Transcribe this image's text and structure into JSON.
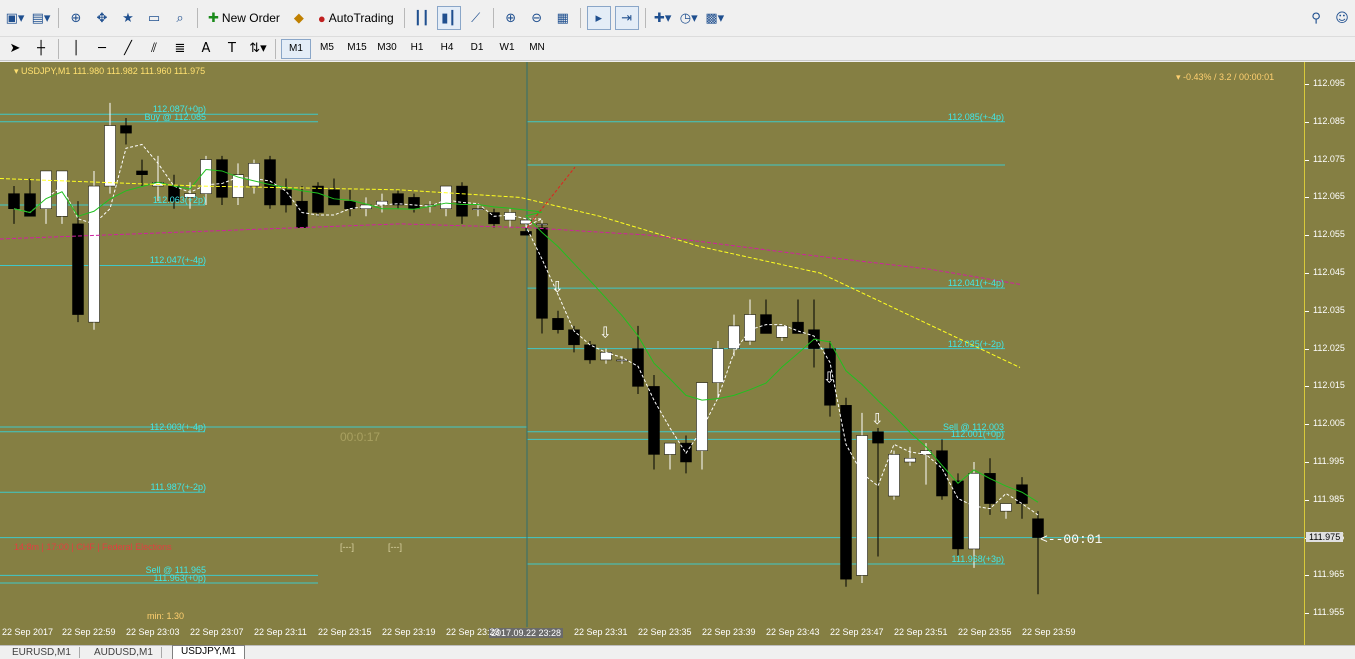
{
  "toolbar": {
    "new_order": "New Order",
    "auto_trading": "AutoTrading"
  },
  "timeframes": [
    "M1",
    "M5",
    "M15",
    "M30",
    "H1",
    "H4",
    "D1",
    "W1",
    "MN"
  ],
  "chart": {
    "header": "USDJPY,M1  111.980 111.982 111.960 111.975",
    "stats": "-0.43% / 3.2 / 00:00:01",
    "countdown": "<--00:01",
    "current_price": "111.975",
    "min_label": "min:  1.30",
    "watermark": "00:0:17",
    "mini1": "[---]",
    "mini2": "[---]",
    "news": "14:8m | 17:00 | CHF | Federal Elections",
    "crosshair_time": "2017.09.22 23:28",
    "price_ticks": [
      "112.095",
      "112.085",
      "112.075",
      "112.065",
      "112.055",
      "112.045",
      "112.035",
      "112.025",
      "112.015",
      "112.005",
      "111.995",
      "111.985",
      "111.975",
      "111.965",
      "111.955"
    ],
    "time_ticks": [
      "22 Sep 2017",
      "22 Sep 22:59",
      "22 Sep 23:03",
      "22 Sep 23:07",
      "22 Sep 23:11",
      "22 Sep 23:15",
      "22 Sep 23:19",
      "22 Sep 23:23",
      "22 Sep 23:31",
      "22 Sep 23:35",
      "22 Sep 23:39",
      "22 Sep 23:43",
      "22 Sep 23:47",
      "22 Sep 23:51",
      "22 Sep 23:55",
      "22 Sep 23:59"
    ],
    "levels_left": [
      {
        "price": 112.087,
        "text": "112.087(+0p)"
      },
      {
        "price": 112.085,
        "text": "Buy @ 112.085"
      },
      {
        "price": 112.063,
        "text": "112.063(+2p)"
      },
      {
        "price": 112.047,
        "text": "112.047(+-4p)"
      },
      {
        "price": 112.003,
        "text": "112.003(+-4p)"
      },
      {
        "price": 111.987,
        "text": "111.987(+-2p)"
      },
      {
        "price": 111.965,
        "text": "Sell @ 111.965"
      },
      {
        "price": 111.963,
        "text": "111.963(+0p)"
      }
    ],
    "levels_right": [
      {
        "price": 112.085,
        "text": "112.085(+-4p)"
      },
      {
        "price": 112.041,
        "text": "112.041(+-4p)"
      },
      {
        "price": 112.025,
        "text": "112.025(+-2p)"
      },
      {
        "price": 112.003,
        "text": "Sell @ 112.003"
      },
      {
        "price": 112.001,
        "text": "112.001(+0p)"
      },
      {
        "price": 111.968,
        "text": "111.968(+3p)"
      }
    ],
    "candles": [
      {
        "o": 112.066,
        "h": 112.068,
        "l": 112.058,
        "c": 112.062
      },
      {
        "o": 112.066,
        "h": 112.07,
        "l": 112.06,
        "c": 112.06
      },
      {
        "o": 112.062,
        "h": 112.065,
        "l": 112.058,
        "c": 112.072
      },
      {
        "o": 112.06,
        "h": 112.07,
        "l": 112.058,
        "c": 112.072
      },
      {
        "o": 112.058,
        "h": 112.064,
        "l": 112.032,
        "c": 112.034
      },
      {
        "o": 112.032,
        "h": 112.072,
        "l": 112.03,
        "c": 112.068
      },
      {
        "o": 112.068,
        "h": 112.09,
        "l": 112.066,
        "c": 112.084
      },
      {
        "o": 112.084,
        "h": 112.086,
        "l": 112.079,
        "c": 112.082
      },
      {
        "o": 112.072,
        "h": 112.075,
        "l": 112.068,
        "c": 112.071
      },
      {
        "o": 112.068,
        "h": 112.076,
        "l": 112.064,
        "c": 112.069
      },
      {
        "o": 112.068,
        "h": 112.071,
        "l": 112.062,
        "c": 112.064
      },
      {
        "o": 112.065,
        "h": 112.069,
        "l": 112.062,
        "c": 112.066
      },
      {
        "o": 112.066,
        "h": 112.076,
        "l": 112.063,
        "c": 112.075
      },
      {
        "o": 112.075,
        "h": 112.076,
        "l": 112.063,
        "c": 112.065
      },
      {
        "o": 112.065,
        "h": 112.074,
        "l": 112.063,
        "c": 112.071
      },
      {
        "o": 112.068,
        "h": 112.075,
        "l": 112.066,
        "c": 112.074
      },
      {
        "o": 112.075,
        "h": 112.076,
        "l": 112.062,
        "c": 112.063
      },
      {
        "o": 112.067,
        "h": 112.07,
        "l": 112.061,
        "c": 112.063
      },
      {
        "o": 112.064,
        "h": 112.068,
        "l": 112.058,
        "c": 112.057
      },
      {
        "o": 112.068,
        "h": 112.069,
        "l": 112.06,
        "c": 112.061
      },
      {
        "o": 112.067,
        "h": 112.07,
        "l": 112.063,
        "c": 112.063
      },
      {
        "o": 112.064,
        "h": 112.067,
        "l": 112.06,
        "c": 112.062
      },
      {
        "o": 112.062,
        "h": 112.065,
        "l": 112.06,
        "c": 112.063
      },
      {
        "o": 112.063,
        "h": 112.066,
        "l": 112.061,
        "c": 112.064
      },
      {
        "o": 112.066,
        "h": 112.067,
        "l": 112.062,
        "c": 112.063
      },
      {
        "o": 112.065,
        "h": 112.066,
        "l": 112.061,
        "c": 112.062
      },
      {
        "o": 112.063,
        "h": 112.064,
        "l": 112.061,
        "c": 112.063
      },
      {
        "o": 112.062,
        "h": 112.064,
        "l": 112.06,
        "c": 112.068
      },
      {
        "o": 112.068,
        "h": 112.069,
        "l": 112.058,
        "c": 112.06
      },
      {
        "o": 112.062,
        "h": 112.063,
        "l": 112.06,
        "c": 112.062
      },
      {
        "o": 112.061,
        "h": 112.062,
        "l": 112.057,
        "c": 112.058
      },
      {
        "o": 112.059,
        "h": 112.062,
        "l": 112.057,
        "c": 112.061
      },
      {
        "o": 112.058,
        "h": 112.059,
        "l": 112.056,
        "c": 112.059
      },
      {
        "o": 112.058,
        "h": 112.059,
        "l": 112.056,
        "c": 112.058
      }
    ],
    "candles2": [
      {
        "o": 112.056,
        "h": 112.057,
        "l": 112.055,
        "c": 112.055
      },
      {
        "o": 112.057,
        "h": 112.058,
        "l": 112.029,
        "c": 112.033
      },
      {
        "o": 112.033,
        "h": 112.035,
        "l": 112.029,
        "c": 112.03
      },
      {
        "o": 112.03,
        "h": 112.031,
        "l": 112.024,
        "c": 112.026
      },
      {
        "o": 112.026,
        "h": 112.027,
        "l": 112.021,
        "c": 112.022
      },
      {
        "o": 112.022,
        "h": 112.025,
        "l": 112.021,
        "c": 112.024
      },
      {
        "o": 112.022,
        "h": 112.023,
        "l": 112.021,
        "c": 112.022
      },
      {
        "o": 112.025,
        "h": 112.031,
        "l": 112.013,
        "c": 112.015
      },
      {
        "o": 112.015,
        "h": 112.018,
        "l": 111.993,
        "c": 111.997
      },
      {
        "o": 111.997,
        "h": 112.0,
        "l": 111.993,
        "c": 112.0
      },
      {
        "o": 112.0,
        "h": 112.002,
        "l": 111.992,
        "c": 111.995
      },
      {
        "o": 111.998,
        "h": 112.016,
        "l": 111.993,
        "c": 112.016
      },
      {
        "o": 112.016,
        "h": 112.027,
        "l": 112.012,
        "c": 112.025
      },
      {
        "o": 112.025,
        "h": 112.034,
        "l": 112.023,
        "c": 112.031
      },
      {
        "o": 112.027,
        "h": 112.038,
        "l": 112.026,
        "c": 112.034
      },
      {
        "o": 112.034,
        "h": 112.038,
        "l": 112.029,
        "c": 112.029
      },
      {
        "o": 112.028,
        "h": 112.031,
        "l": 112.027,
        "c": 112.031
      },
      {
        "o": 112.032,
        "h": 112.038,
        "l": 112.029,
        "c": 112.029
      },
      {
        "o": 112.03,
        "h": 112.038,
        "l": 112.02,
        "c": 112.025
      },
      {
        "o": 112.025,
        "h": 112.027,
        "l": 112.007,
        "c": 112.01
      },
      {
        "o": 112.01,
        "h": 112.012,
        "l": 111.962,
        "c": 111.964
      },
      {
        "o": 111.965,
        "h": 112.008,
        "l": 111.963,
        "c": 112.002
      },
      {
        "o": 112.003,
        "h": 112.004,
        "l": 111.97,
        "c": 112.0
      },
      {
        "o": 111.986,
        "h": 111.998,
        "l": 111.985,
        "c": 111.997
      },
      {
        "o": 111.995,
        "h": 111.999,
        "l": 111.994,
        "c": 111.996
      },
      {
        "o": 111.997,
        "h": 112.0,
        "l": 111.989,
        "c": 111.998
      },
      {
        "o": 111.998,
        "h": 112.001,
        "l": 111.985,
        "c": 111.986
      },
      {
        "o": 111.99,
        "h": 111.992,
        "l": 111.97,
        "c": 111.972
      },
      {
        "o": 111.972,
        "h": 111.995,
        "l": 111.967,
        "c": 111.992
      },
      {
        "o": 111.992,
        "h": 111.996,
        "l": 111.981,
        "c": 111.984
      },
      {
        "o": 111.982,
        "h": 111.984,
        "l": 111.98,
        "c": 111.984
      },
      {
        "o": 111.989,
        "h": 111.991,
        "l": 111.98,
        "c": 111.984
      },
      {
        "o": 111.98,
        "h": 111.982,
        "l": 111.96,
        "c": 111.975
      }
    ],
    "colors": {
      "background": "#857f43",
      "bull": "#ffffff",
      "bear": "#000000",
      "level_line": "#3fc8c8",
      "ma_fast": "#ffffff",
      "ma_mid": "#20c020",
      "ma_slow": "#ffff20",
      "ma_slowest": "#d020a0"
    }
  },
  "tabs": [
    "EURUSD,M1",
    "AUDUSD,M1",
    "USDJPY,M1"
  ]
}
